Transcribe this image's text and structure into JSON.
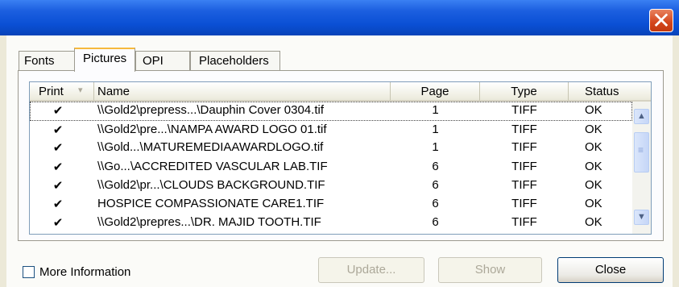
{
  "window": {
    "title": "",
    "close_glyph": "✕"
  },
  "tabs": [
    {
      "label": "Fonts",
      "active": false
    },
    {
      "label": "Pictures",
      "active": true
    },
    {
      "label": "OPI",
      "active": false
    },
    {
      "label": "Placeholders",
      "active": false
    }
  ],
  "table": {
    "columns": {
      "print": "Print",
      "sort_glyph": "▾",
      "name": "Name",
      "page": "Page",
      "type": "Type",
      "status": "Status"
    },
    "check_glyph": "✔",
    "rows": [
      {
        "print": "✔",
        "name": "\\\\Gold2\\prepress...\\Dauphin Cover 0304.tif",
        "page": "1",
        "type": "TIFF",
        "status": "OK"
      },
      {
        "print": "✔",
        "name": "\\\\Gold2\\pre...\\NAMPA AWARD LOGO 01.tif",
        "page": "1",
        "type": "TIFF",
        "status": "OK"
      },
      {
        "print": "✔",
        "name": "\\\\Gold...\\MATUREMEDIAAWARDLOGO.tif",
        "page": "1",
        "type": "TIFF",
        "status": "OK"
      },
      {
        "print": "✔",
        "name": "\\\\Go...\\ACCREDITED VASCULAR LAB.TIF",
        "page": "6",
        "type": "TIFF",
        "status": "OK"
      },
      {
        "print": "✔",
        "name": "\\\\Gold2\\pr...\\CLOUDS BACKGROUND.TIF",
        "page": "6",
        "type": "TIFF",
        "status": "OK"
      },
      {
        "print": "✔",
        "name": "HOSPICE COMPASSIONATE CARE1.TIF",
        "page": "6",
        "type": "TIFF",
        "status": "OK"
      },
      {
        "print": "✔",
        "name": "\\\\Gold2\\prepres...\\DR. MAJID TOOTH.TIF",
        "page": "6",
        "type": "TIFF",
        "status": "OK"
      }
    ],
    "scroll_up_glyph": "▲",
    "scroll_down_glyph": "▼",
    "thumb_grip_glyph": "≡"
  },
  "footer": {
    "more_info_label": "More Information",
    "more_info_checked": false,
    "update_label": "Update...",
    "show_label": "Show",
    "close_label": "Close"
  },
  "colors": {
    "title_bar": "#0a4fd4",
    "close_button": "#d3451b",
    "active_tab_accent": "#f6b93d"
  }
}
